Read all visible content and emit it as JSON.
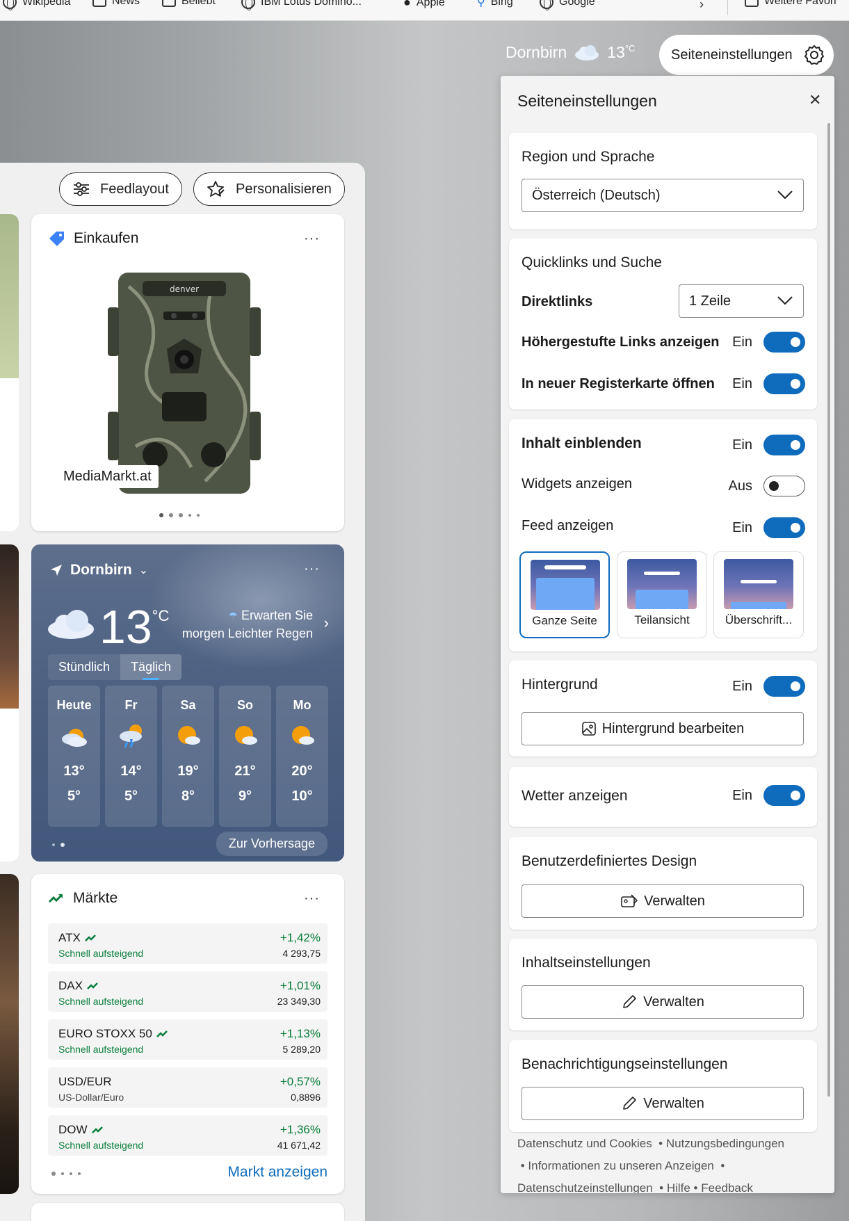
{
  "bookmarks": [
    {
      "label": "Wikipedia",
      "icon": "globe-icon"
    },
    {
      "label": "News",
      "icon": "folder-icon"
    },
    {
      "label": "Beliebt",
      "icon": "folder-icon"
    },
    {
      "label": "IBM Lotus Domino...",
      "icon": "globe-icon"
    },
    {
      "label": "Apple",
      "icon": "apple-icon"
    },
    {
      "label": "Bing",
      "icon": "search-icon"
    },
    {
      "label": "Google",
      "icon": "globe-icon"
    },
    {
      "label": "Weitere Favori",
      "icon": "folder-icon"
    }
  ],
  "top_weather": {
    "city": "Dornbirn",
    "temp": "13",
    "unit": "°C"
  },
  "settings_pill": {
    "label": "Seiteneinstellungen"
  },
  "feed": {
    "feedlayout_label": "Feedlayout",
    "personalize_label": "Personalisieren",
    "shopping": {
      "title": "Einkaufen",
      "more": "···",
      "brand": "denver",
      "store": "MediaMarkt.at"
    },
    "weather": {
      "location": "Dornbirn",
      "more": "···",
      "temp": "13",
      "unit": "°C",
      "forecast_line1": "Erwarten Sie",
      "forecast_line2": "morgen Leichter Regen",
      "tab_hourly": "Stündlich",
      "tab_daily": "Täglich",
      "days": [
        {
          "name": "Heute",
          "hi": "13°",
          "lo": "5°",
          "icon": "partly-cloudy-icon"
        },
        {
          "name": "Fr",
          "hi": "14°",
          "lo": "5°",
          "icon": "rain-icon"
        },
        {
          "name": "Sa",
          "hi": "19°",
          "lo": "8°",
          "icon": "sun-cloud-icon"
        },
        {
          "name": "So",
          "hi": "21°",
          "lo": "9°",
          "icon": "sun-cloud-icon"
        },
        {
          "name": "Mo",
          "hi": "20°",
          "lo": "10°",
          "icon": "sun-cloud-icon"
        }
      ],
      "more_forecast": "Zur Vorhersage"
    },
    "markets": {
      "title": "Märkte",
      "more": "···",
      "rows": [
        {
          "name": "ATX",
          "sub": "Schnell aufsteigend",
          "change": "+1,42%",
          "value": "4 293,75",
          "trend": true
        },
        {
          "name": "DAX",
          "sub": "Schnell aufsteigend",
          "change": "+1,01%",
          "value": "23 349,30",
          "trend": true
        },
        {
          "name": "EURO STOXX 50",
          "sub": "Schnell aufsteigend",
          "change": "+1,13%",
          "value": "5 289,20",
          "trend": true
        },
        {
          "name": "USD/EUR",
          "sub": "US-Dollar/Euro",
          "change": "+0,57%",
          "value": "0,8896",
          "trend": false
        },
        {
          "name": "DOW",
          "sub": "Schnell aufsteigend",
          "change": "+1,36%",
          "value": "41 671,42",
          "trend": true
        }
      ],
      "show_label": "Markt anzeigen"
    }
  },
  "panel": {
    "title": "Seiteneinstellungen",
    "region": {
      "heading": "Region und Sprache",
      "value": "Österreich (Deutsch)"
    },
    "quicklinks": {
      "heading": "Quicklinks und Suche",
      "direktlinks_label": "Direktlinks",
      "direktlinks_value": "1 Zeile",
      "promoted_label": "Höhergestufte Links anzeigen",
      "promoted_state": "Ein",
      "newtab_label": "In neuer Registerkarte öffnen",
      "newtab_state": "Ein"
    },
    "content": {
      "show_label": "Inhalt einblenden",
      "show_state": "Ein",
      "widgets_label": "Widgets anzeigen",
      "widgets_state": "Aus",
      "feed_label": "Feed anzeigen",
      "feed_state": "Ein",
      "layouts": [
        "Ganze Seite",
        "Teilansicht",
        "Überschrift..."
      ]
    },
    "background": {
      "heading": "Hintergrund",
      "state": "Ein",
      "edit_label": "Hintergrund bearbeiten"
    },
    "weather": {
      "heading": "Wetter anzeigen",
      "state": "Ein"
    },
    "custom_design": {
      "heading": "Benutzerdefiniertes Design",
      "button": "Verwalten"
    },
    "content_settings": {
      "heading": "Inhaltseinstellungen",
      "button": "Verwalten"
    },
    "notification_settings": {
      "heading": "Benachrichtigungseinstellungen",
      "button": "Verwalten"
    },
    "footer": {
      "privacy": "Datenschutz und Cookies",
      "terms": "Nutzungsbedingungen",
      "ads": "Informationen zu unseren Anzeigen",
      "privacy_settings": "Datenschutzeinstellungen",
      "help": "Hilfe",
      "feedback": "Feedback"
    }
  },
  "colors": {
    "accent": "#0f6cbd",
    "positive": "#0a7e3c",
    "link": "#0f6cbd"
  }
}
